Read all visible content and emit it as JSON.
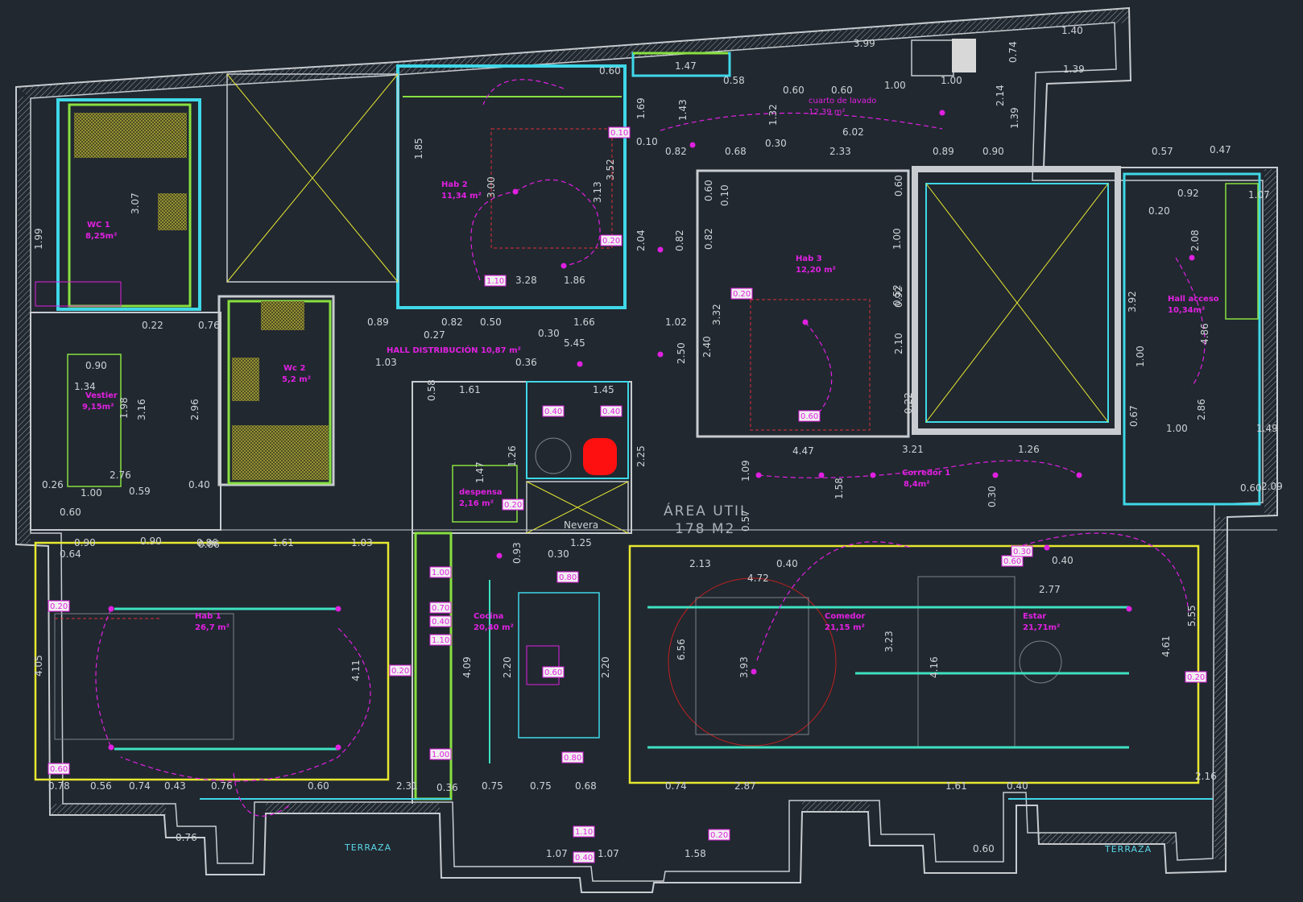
{
  "plan": {
    "summary": {
      "line1": "ÁREA UTIL",
      "line2": "178 M2"
    },
    "rooms": [
      {
        "name": "WC 1",
        "area": "8,25m²"
      },
      {
        "name": "Hab 2",
        "area": "11,34 m²"
      },
      {
        "name": "Hab 3",
        "area": "12,20 m²"
      },
      {
        "name": "Hall acceso",
        "area": "10,34m²"
      },
      {
        "name": "cuarto de lavado",
        "area": "12,39 m²"
      },
      {
        "name": "HALL DISTRIBUCIÓN 10,87 m²",
        "area": ""
      },
      {
        "name": "Wc 2",
        "area": "5,2 m²"
      },
      {
        "name": "Vestier",
        "area": "9,15m²"
      },
      {
        "name": "despensa",
        "area": "2,16 m²"
      },
      {
        "name": "Corredor 1",
        "area": "8,4m²"
      },
      {
        "name": "Hab 1",
        "area": "26,7 m²"
      },
      {
        "name": "Cocina",
        "area": "20,40 m²"
      },
      {
        "name": "Comedor",
        "area": "21,15 m²"
      },
      {
        "name": "Estar",
        "area": "21,71m²"
      }
    ],
    "terraces": [
      "TERRAZA",
      "TERRAZA"
    ],
    "appliance": "Nevera",
    "dims": [
      "1.40",
      "3.99",
      "1.39",
      "1.47",
      "0.60",
      "0.58",
      "0.60",
      "0.60",
      "1.00",
      "1.00",
      "6.02",
      "0.10",
      "0.82",
      "0.68",
      "0.30",
      "2.33",
      "0.89",
      "0.90",
      "0.57",
      "0.47",
      "0.92",
      "1.07",
      "0.20",
      "3.28",
      "1.86",
      "0.82",
      "0.50",
      "1.66",
      "1.02",
      "0.89",
      "0.27",
      "0.30",
      "5.45",
      "0.36",
      "1.03",
      "1.61",
      "1.45",
      "0.90",
      "1.34",
      "2.76",
      "0.26",
      "1.00",
      "0.40",
      "0.59",
      "0.90",
      "0.86",
      "1.61",
      "1.03",
      "0.90",
      "0.60",
      "0.64",
      "0.22",
      "0.76",
      "0.86",
      "1.25",
      "0.30",
      "0.40",
      "2.13",
      "4.72",
      "0.40",
      "2.77",
      "4.47",
      "3.21",
      "1.26",
      "1.00",
      "1.49",
      "0.60",
      "2.09",
      "0.78",
      "0.56",
      "0.74",
      "0.43",
      "0.76",
      "0.60",
      "2.31",
      "0.36",
      "0.75",
      "0.75",
      "0.68",
      "0.74",
      "2.87",
      "1.61",
      "0.40",
      "2.16",
      "0.60",
      "1.07",
      "1.58",
      "1.07",
      "0.76"
    ],
    "vdims": [
      "3.52",
      "3.13",
      "3.00",
      "1.85",
      "2.04",
      "0.82",
      "2.50",
      "2.25",
      "1.69",
      "1.43",
      "2.14",
      "1.39",
      "0.74",
      "1.32",
      "3.92",
      "4.86",
      "2.86",
      "2.08",
      "1.00",
      "0.67",
      "4.05",
      "4.11",
      "4.09",
      "2.20",
      "2.20",
      "6.56",
      "3.93",
      "3.23",
      "4.16",
      "5.55",
      "4.61",
      "3.07",
      "1.99",
      "2.96",
      "3.16",
      "1.98",
      "1.09",
      "0.57",
      "1.58",
      "0.30",
      "0.92",
      "2.10",
      "0.22",
      "2.40",
      "3.32",
      "0.60",
      "0.10",
      "0.82",
      "0.60",
      "1.00",
      "0.52",
      "0.58",
      "1.26",
      "1.47",
      "0.93"
    ],
    "tags": [
      "0.20",
      "0.40",
      "0.40",
      "0.60",
      "0.20",
      "1.00",
      "0.80",
      "1.00",
      "0.70",
      "0.40",
      "1.10",
      "1.10",
      "0.60",
      "0.80",
      "0.20",
      "0.20",
      "0.20",
      "0.60",
      "0.20",
      "0.20",
      "0.10",
      "0.40",
      "0.60",
      "0.30",
      "1.10"
    ]
  }
}
